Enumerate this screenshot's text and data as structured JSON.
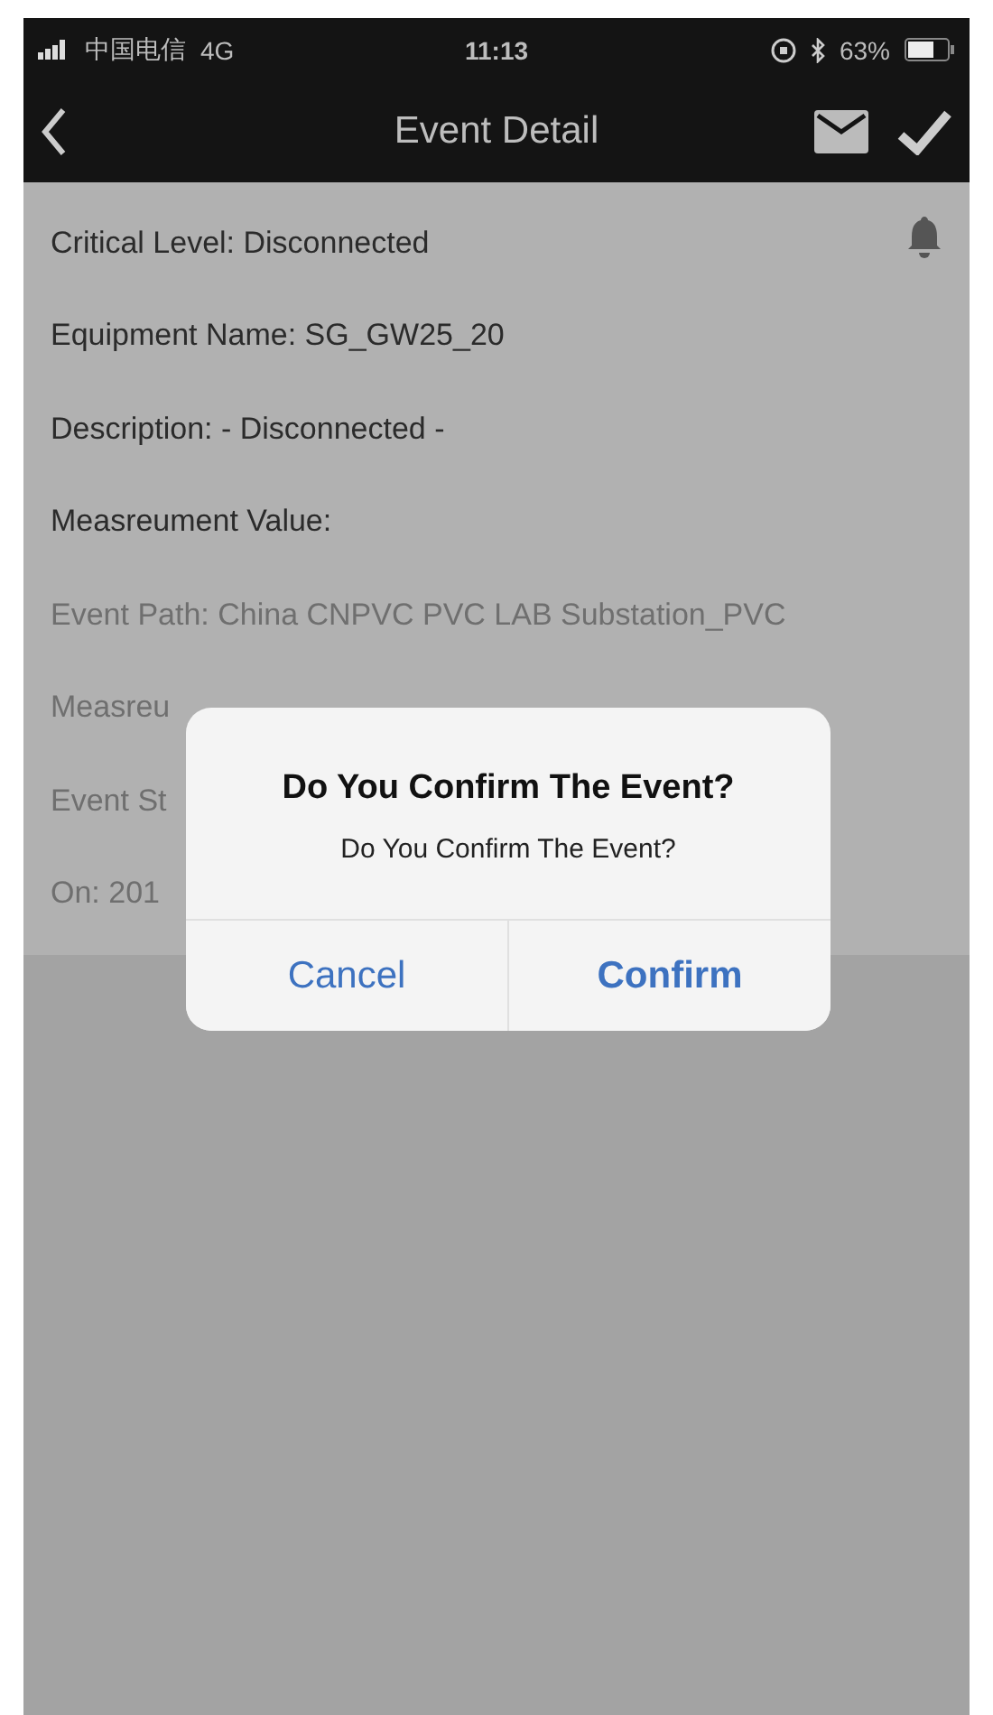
{
  "status_bar": {
    "carrier": "中国电信",
    "network": "4G",
    "time": "11:13",
    "battery_percent": "63%"
  },
  "nav_bar": {
    "title": "Event Detail"
  },
  "fields": [
    {
      "text": "Critical Level: Disconnected",
      "dimmed": false
    },
    {
      "text": "Equipment Name: SG_GW25_20",
      "dimmed": false
    },
    {
      "text": "Description: - Disconnected -",
      "dimmed": false
    },
    {
      "text": "Measreument Value:",
      "dimmed": false
    },
    {
      "text": "Event Path: China CNPVC PVC LAB Substation_PVC",
      "dimmed": true
    },
    {
      "text": "Measreu",
      "dimmed": true
    },
    {
      "text": "Event St",
      "dimmed": true
    },
    {
      "text": "On: 201",
      "dimmed": true
    }
  ],
  "dialog": {
    "title": "Do You Confirm The Event?",
    "message": "Do You Confirm The Event?",
    "buttons": [
      {
        "label": "Cancel",
        "emphasized": false
      },
      {
        "label": "Confirm",
        "emphasized": true
      }
    ]
  }
}
